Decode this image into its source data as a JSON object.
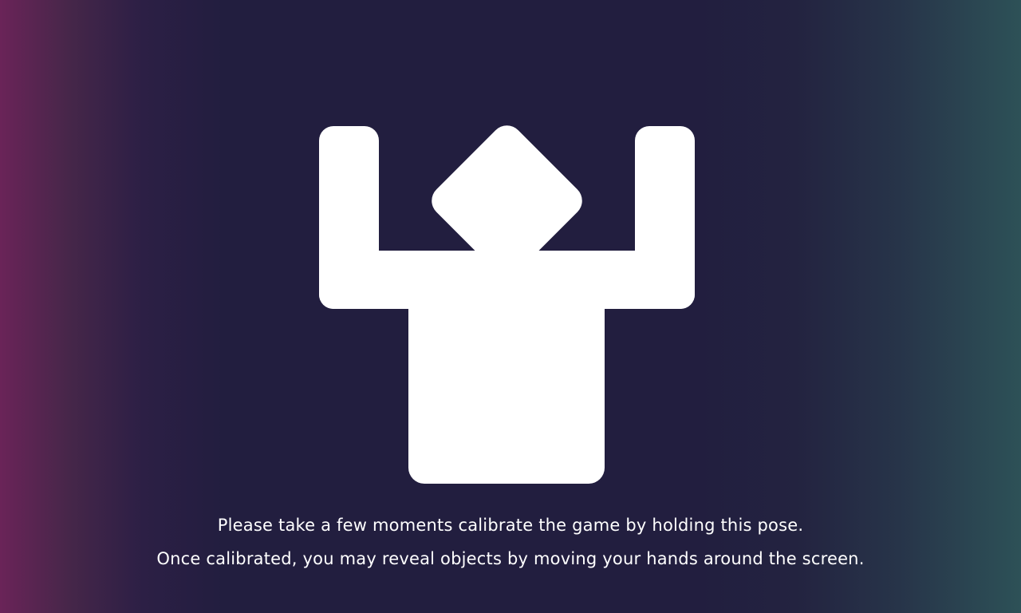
{
  "calibration": {
    "pose_icon": "arms-raised-pose-icon",
    "line1": "Please take a few moments calibrate the game by holding this pose.",
    "line2": "Once calibrated, you may reveal objects by moving your hands around the screen."
  },
  "colors": {
    "figure": "#ffffff",
    "text": "#ffffff",
    "background_center": "#221e3f",
    "background_left_edge": "#6a2458",
    "background_right_edge": "#2d5157"
  }
}
